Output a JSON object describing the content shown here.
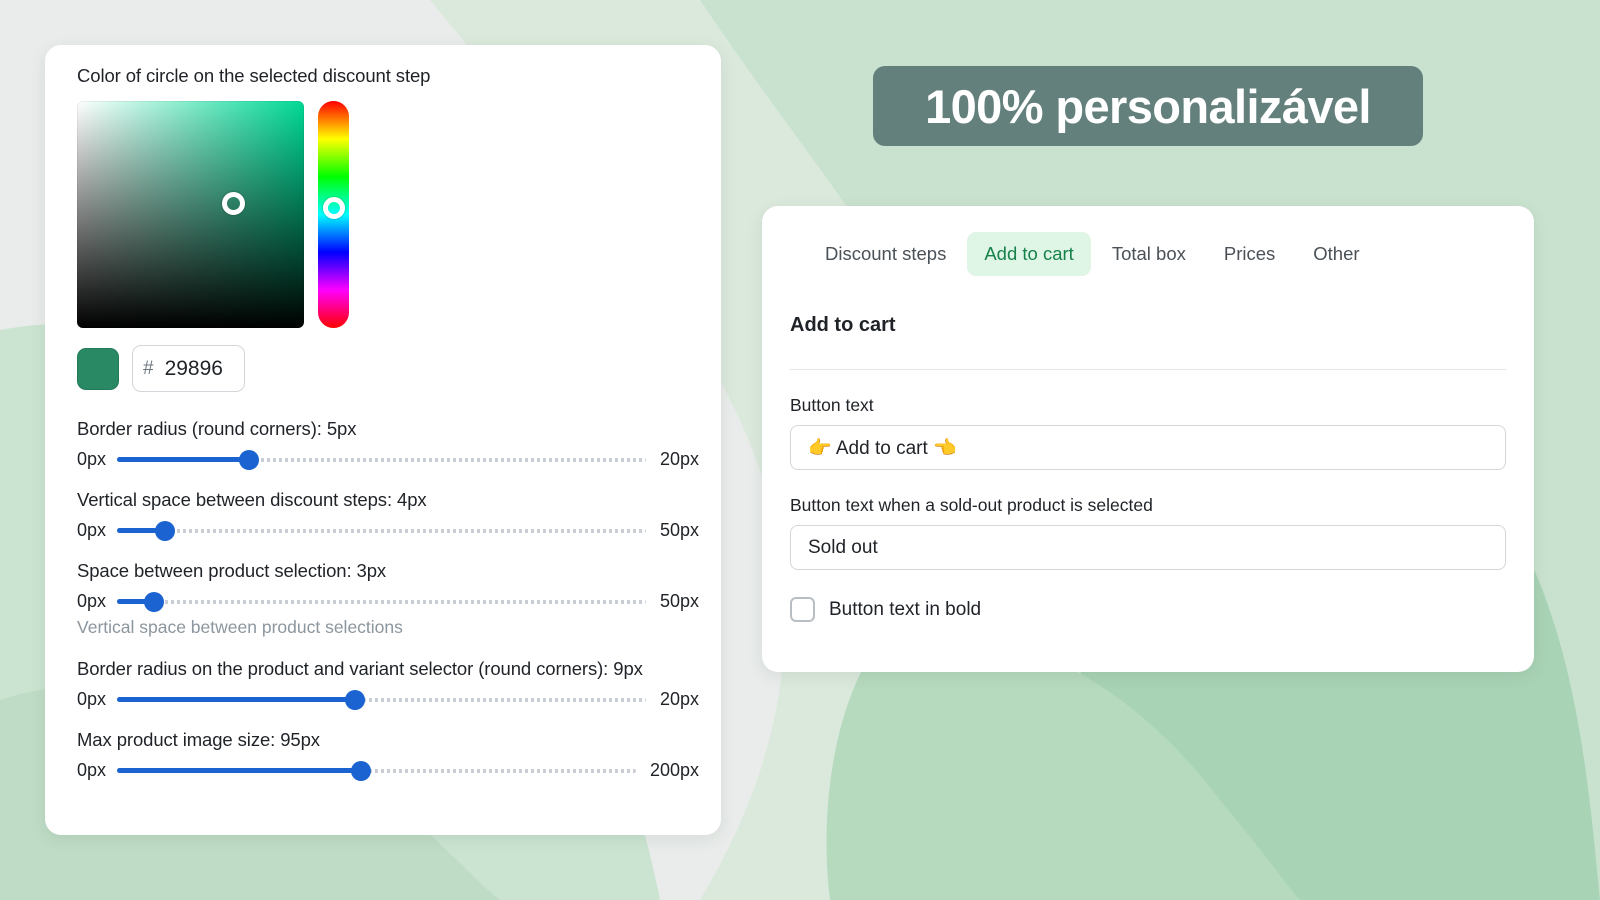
{
  "background": {
    "base_color": "#e9ecea",
    "blob_colors": [
      "#dbe9dd",
      "#bfdcc6",
      "#a9d3b5",
      "#9ecbad"
    ]
  },
  "banner": {
    "text": "100% personalizável",
    "bg_color": "#63807d",
    "text_color": "#ffffff"
  },
  "color_picker": {
    "title": "Color of circle on the selected discount step",
    "swatch_color": "#298965",
    "hex_prefix": "#",
    "hex_value": "29896",
    "sat_marker_x_pct": 69,
    "sat_marker_y_pct": 45,
    "hue_marker_y_pct": 47,
    "saturation_hue_color": "#00d995"
  },
  "sliders": [
    {
      "label": "Border radius (round corners): 5px",
      "min_label": "0px",
      "max_label": "20px",
      "value": 5,
      "min": 0,
      "max": 20,
      "percent": 25,
      "helper": null
    },
    {
      "label": "Vertical space between discount steps: 4px",
      "min_label": "0px",
      "max_label": "50px",
      "value": 4,
      "min": 0,
      "max": 50,
      "percent": 9,
      "helper": null
    },
    {
      "label": "Space between product selection: 3px",
      "min_label": "0px",
      "max_label": "50px",
      "value": 3,
      "min": 0,
      "max": 50,
      "percent": 7,
      "helper": "Vertical space between product selections"
    },
    {
      "label": "Border radius on the product and variant selector (round corners): 9px",
      "min_label": "0px",
      "max_label": "20px",
      "value": 9,
      "min": 0,
      "max": 20,
      "percent": 45,
      "helper": null
    },
    {
      "label": "Max product image size: 95px",
      "min_label": "0px",
      "max_label": "200px",
      "value": 95,
      "min": 0,
      "max": 200,
      "percent": 47,
      "helper": null
    }
  ],
  "slider_colors": {
    "fill": "#1a63d0",
    "rest": "#c9ced4"
  },
  "panel": {
    "tabs": [
      {
        "label": "Discount steps",
        "active": false
      },
      {
        "label": "Add to cart",
        "active": true
      },
      {
        "label": "Total box",
        "active": false
      },
      {
        "label": "Prices",
        "active": false
      },
      {
        "label": "Other",
        "active": false
      }
    ],
    "active_tab_bg": "#dff5e6",
    "active_tab_color": "#17814a",
    "section_title": "Add to cart",
    "fields": [
      {
        "label": "Button text",
        "value": "👉 Add to cart 👈"
      },
      {
        "label": "Button text when a sold-out product is selected",
        "value": "Sold out"
      }
    ],
    "checkbox": {
      "label": "Button text in bold",
      "checked": false
    }
  }
}
